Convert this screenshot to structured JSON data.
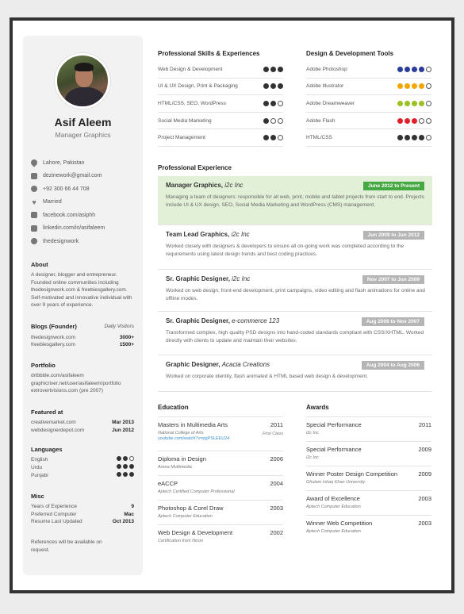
{
  "profile": {
    "name": "Asif Aleem",
    "role": "Manager Graphics"
  },
  "contacts": [
    {
      "icon": "location-pin-icon",
      "text": "Lahore, Pakistan"
    },
    {
      "icon": "mail-icon",
      "text": "dezinework@gmail.com"
    },
    {
      "icon": "phone-icon",
      "text": "+92 300 66 44 708"
    },
    {
      "icon": "heart-icon",
      "text": "Married"
    },
    {
      "icon": "facebook-icon",
      "text": "facebook.com/asiphh"
    },
    {
      "icon": "linkedin-icon",
      "text": "linkedin.com/in/asifaleem"
    },
    {
      "icon": "skype-icon",
      "text": "thedesignwork"
    }
  ],
  "about": {
    "title": "About",
    "text": "A designer, blogger and entrepreneur. Founded online communities including thedesignwork.com & freebiesgallery.com. Self-motivated and innovative individual with over 9 years of experience."
  },
  "blogs": {
    "title": "Blogs (Founder)",
    "subtitle": "Daily Visitors",
    "items": [
      {
        "name": "thedesignwork.com",
        "value": "3000+"
      },
      {
        "name": "freebiesgallery.com",
        "value": "1500+"
      }
    ]
  },
  "portfolio": {
    "title": "Portfolio",
    "items": [
      "dribbble.com/asifaleem",
      "graphicriver.net/user/asifaleem/portfolio",
      "extrovertvisions.com (pre 2007)"
    ]
  },
  "featured": {
    "title": "Featured at",
    "items": [
      {
        "name": "creativemarket.com",
        "value": "Mar 2013"
      },
      {
        "name": "webdesignerdepot.com",
        "value": "Jun 2012"
      }
    ]
  },
  "languages": {
    "title": "Languages",
    "items": [
      {
        "name": "English",
        "level": 2
      },
      {
        "name": "Urdu",
        "level": 3
      },
      {
        "name": "Punjabi",
        "level": 3
      }
    ]
  },
  "misc": {
    "title": "Misc",
    "items": [
      {
        "name": "Years of Experience",
        "value": "9"
      },
      {
        "name": "Preferred Computer",
        "value": "Mac"
      },
      {
        "name": "Resume Last Updated",
        "value": "Oct 2013"
      }
    ]
  },
  "references": "References will be available on request.",
  "skills": {
    "title": "Professional Skills & Experiences",
    "items": [
      {
        "name": "Web Design & Development",
        "level": 3
      },
      {
        "name": "UI & UX Design, Print & Packaging",
        "level": 3
      },
      {
        "name": "HTML/CSS, SEO, WordPress",
        "level": 2
      },
      {
        "name": "Social Media Marketing",
        "level": 1
      },
      {
        "name": "Project Management",
        "level": 2
      }
    ]
  },
  "tools": {
    "title": "Design & Development Tools",
    "items": [
      {
        "name": "Adobe Photoshop",
        "level": 4,
        "color": "#2b3d9b"
      },
      {
        "name": "Adobe Illustrator",
        "level": 4,
        "color": "#f2a600"
      },
      {
        "name": "Adobe Dreamweaver",
        "level": 4,
        "color": "#9cc126"
      },
      {
        "name": "Adobe Flash",
        "level": 3,
        "color": "#e0202a"
      },
      {
        "name": "HTML/CSS",
        "level": 4,
        "color": "#333333"
      }
    ]
  },
  "experience": {
    "title": "Professional Experience",
    "items": [
      {
        "title": "Manager Graphics,",
        "company": "i2c Inc",
        "period": "June 2012 to Present",
        "desc": "Managing a team of designers: responsible for all web, print, mobile and tablet projects from start to end. Projects include UI & UX design, SEO, Social Media Marketing and WordPress (CMS) management."
      },
      {
        "title": "Team Lead Graphics,",
        "company": "i2c Inc",
        "period": "Jun 2009 to Jun 2012",
        "desc": "Worked closely with designers & developers to ensure all on-going work was completed according to the requirements using latest design trends and best coding practices."
      },
      {
        "title": "Sr. Graphic Designer,",
        "company": "i2c Inc",
        "period": "Nov 2007 to Jun 2009",
        "desc": "Worked on web design, front-end development, print campaigns, video editing and flash animations for online and offline modes."
      },
      {
        "title": "Sr. Graphic Designer,",
        "company": "e-commerce 123",
        "period": "Aug 2006 to Nov 2007",
        "desc": "Transformed complex, high quality PSD designs into hand-coded standards compliant with CSS/XHTML. Worked directly with clients to update and maintain their websites."
      },
      {
        "title": "Graphic Designer,",
        "company": "Acacia Creations",
        "period": "Aug 2004 to Aug 2006",
        "desc": "Worked on corporate identity, flash animated & HTML based web design & development."
      }
    ]
  },
  "education": {
    "title": "Education",
    "items": [
      {
        "name": "Masters in Multimedia Arts",
        "year": "2011",
        "sub": "National College of Arts",
        "sub2": "First Class",
        "link": "youtube.com/watch?v=pgPSLEEU24"
      },
      {
        "name": "Diploma in Design",
        "year": "2006",
        "sub": "Arena Multimedia"
      },
      {
        "name": "eACCP",
        "year": "2004",
        "sub": "Aptech Certified Computer Professional"
      },
      {
        "name": "Photoshop & Corel Draw",
        "year": "2003",
        "sub": "Aptech Computer Education"
      },
      {
        "name": "Web Design & Development",
        "year": "2002",
        "sub": "Certification from Nicon"
      }
    ]
  },
  "awards": {
    "title": "Awards",
    "items": [
      {
        "name": "Special Performance",
        "year": "2011",
        "sub": "i2c Inc"
      },
      {
        "name": "Special Performance",
        "year": "2009",
        "sub": "i2c Inc"
      },
      {
        "name": "Winner Poster Design Competition",
        "year": "2009",
        "sub": "Ghulam Ishaq Khan University"
      },
      {
        "name": "Award of Excellence",
        "year": "2003",
        "sub": "Aptech Computer Education"
      },
      {
        "name": "Winner Web Competition",
        "year": "2003",
        "sub": "Aptech Computer Education"
      }
    ]
  }
}
